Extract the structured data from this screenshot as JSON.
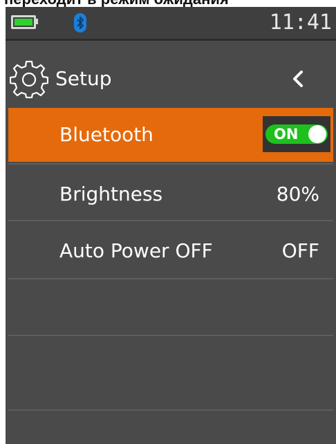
{
  "caption": "переходит в режим ожидания",
  "status_bar": {
    "time": "11:41",
    "battery_level": 1.0,
    "battery_icon": "battery-icon",
    "bluetooth_icon": "bluetooth-icon"
  },
  "header": {
    "title": "Setup",
    "icon": "gear-icon",
    "back_icon": "chevron-left-icon"
  },
  "settings": [
    {
      "label": "Bluetooth",
      "value": "ON",
      "type": "toggle",
      "selected": true
    },
    {
      "label": "Brightness",
      "value": "80%",
      "type": "value",
      "selected": false
    },
    {
      "label": "Auto Power OFF",
      "value": "OFF",
      "type": "value",
      "selected": false
    }
  ],
  "colors": {
    "screen_bg": "#4a4a4a",
    "selected_row": "#e46a0c",
    "toggle_on": "#1ec01e",
    "battery_fill": "#2fd12f",
    "bluetooth": "#1b7fd8"
  }
}
